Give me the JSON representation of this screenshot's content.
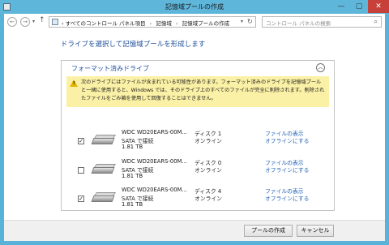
{
  "window": {
    "title": "記憶域プールの作成",
    "min_icon": "—",
    "max_icon": "▢",
    "close_icon": "✕"
  },
  "nav": {
    "back_glyph": "←",
    "forward_glyph": "→",
    "up_glyph": "↑",
    "breadcrumb": [
      "すべてのコントロール パネル項目",
      "記憶域",
      "記憶域プールの作成"
    ],
    "search_placeholder": "コントロール パネルの検索"
  },
  "page": {
    "heading": "ドライブを選択して記憶域プールを形成します"
  },
  "panel": {
    "title": "フォーマット済みドライブ",
    "warning": "次のドライブにはファイルが含まれている可能性があります。フォーマット済みのドライブを記憶域プールと一緒に使用すると、Windows では、そのドライブ上のすべてのファイルが完全に削除されます。削除されたファイルをごみ箱を使用して回復することはできません。",
    "drives": [
      {
        "checked": true,
        "name": "WDC WD20EARS-00M...",
        "connection": "SATA で接続",
        "size": "1.81 TB",
        "disk": "ディスク 1",
        "status": "オンライン",
        "link_files": "ファイルの表示",
        "link_offline": "オフラインにする"
      },
      {
        "checked": false,
        "name": "WDC WD20EARS-00M...",
        "connection": "SATA で接続",
        "size": "1.81 TB",
        "disk": "ディスク 0",
        "status": "オンライン",
        "link_files": "ファイルの表示",
        "link_offline": "オフラインにする"
      },
      {
        "checked": true,
        "name": "WDC WD20EARS-00M...",
        "connection": "SATA で接続",
        "size": "1.81 TB",
        "disk": "ディスク 4",
        "status": "オンライン",
        "link_files": "ファイルの表示",
        "link_offline": "オフラインにする"
      }
    ]
  },
  "footer": {
    "create_label": "プールの作成",
    "cancel_label": "キャンセル"
  },
  "icons": {
    "back": "back-arrow-icon",
    "forward": "forward-arrow-icon",
    "up": "up-arrow-icon",
    "search": "search-icon",
    "collapse": "chevron-up-icon",
    "warning": "warning-icon",
    "drive": "hard-drive-icon"
  },
  "colors": {
    "titlebar": "#5fb6db",
    "heading": "#1e4f9c",
    "link": "#1e5fb5",
    "warning_bg": "#fbf1a6",
    "close": "#c7403a"
  }
}
